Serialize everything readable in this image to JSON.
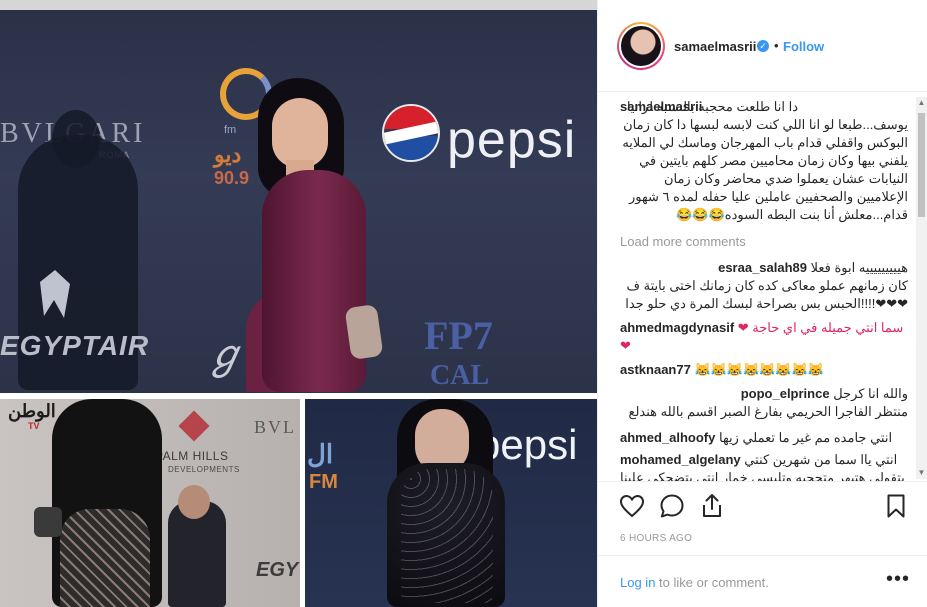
{
  "media": {
    "top_photo": {
      "signs": {
        "bvlgari": "BVLGARI",
        "roma": "ROMA",
        "radio_fm": "fm",
        "radio_number": "ديو",
        "radio_freq": "90.9",
        "egyptair": "EGYPTAIR",
        "pepsi": "pepsi",
        "fp7": "FP7",
        "cal": "CAL"
      }
    },
    "bottom_left_photo": {
      "signs": {
        "watan": "الوطن",
        "watan_tv": "TV",
        "palm_hills": "PALM HILLS",
        "palm_sub": "DEVELOPMENTS",
        "bvl": "BVL",
        "egy": "EGY"
      }
    },
    "bottom_right_photo": {
      "signs": {
        "pepsi": "pepsi",
        "alef": "ال",
        "fm": "FM"
      }
    }
  },
  "post": {
    "header": {
      "username": "samaelmasrii",
      "follow_label": "Follow",
      "dot": "•"
    },
    "caption": {
      "username": "samaelmasrii",
      "text": "دا انا طلعت محجبه بالنسبه لرانيا يوسف...طبعا لو انا اللي كنت لابسه لبسها دا كان زمان البوكس واقفلي قدام باب المهرجان وماسك لي الملايه يلفني بيها وكان زمان محاميين مصر كلهم بايتين في النيابات عشان يعملوا ضدي محاضر وكان زمان الإعلاميين والصحفيين عاملين عليا حفله لمده ٦ شهور قدام...معلش أنا بنت البطه السوده😂😂😂"
    },
    "load_more_label": "Load more comments",
    "comments": [
      {
        "username": "esraa_salah89",
        "text": "هيييييييييه ابوة فعلا كان زمانهم عملو معاكى كده كان زمانك اختى بايتة ف الحبس بس بصراحة لبسك المرة دي حلو جدا!!!!❤❤❤"
      },
      {
        "username": "ahmedmagdynasif",
        "text": "سما انتي جميله في اي حاجة ❤ ❤"
      },
      {
        "username": "astknaan77",
        "text": "😹😹😹😹😹😹😹😹"
      },
      {
        "username": "popo_elprince",
        "text": "والله انا كرجل منتظر الفاجرا الحريمي بفارغ الصبر اقسم بالله هندلع"
      },
      {
        "username": "ahmed_alhoofy",
        "text": "انتي جامده مم غير ما تعملي زيها"
      },
      {
        "username": "mohamed_algelany",
        "text": "انتي ياا سما من شهرين كنتي بتقولي هتبهر متحجبه وتلبسي خمار انتي بتضحكي علينا"
      }
    ],
    "timestamp": "6 HOURS AGO",
    "footer": {
      "login_link": "Log in",
      "login_rest": " to like or comment.",
      "more_label": "•••"
    }
  },
  "colors": {
    "link_blue": "#3897f0",
    "text": "#262626",
    "muted": "#999999",
    "border": "#efefef"
  },
  "icons": [
    "verified-badge-icon",
    "heart-icon",
    "comment-icon",
    "share-icon",
    "bookmark-icon",
    "more-options-icon",
    "scroll-up-arrow-icon",
    "scroll-down-arrow-icon"
  ]
}
